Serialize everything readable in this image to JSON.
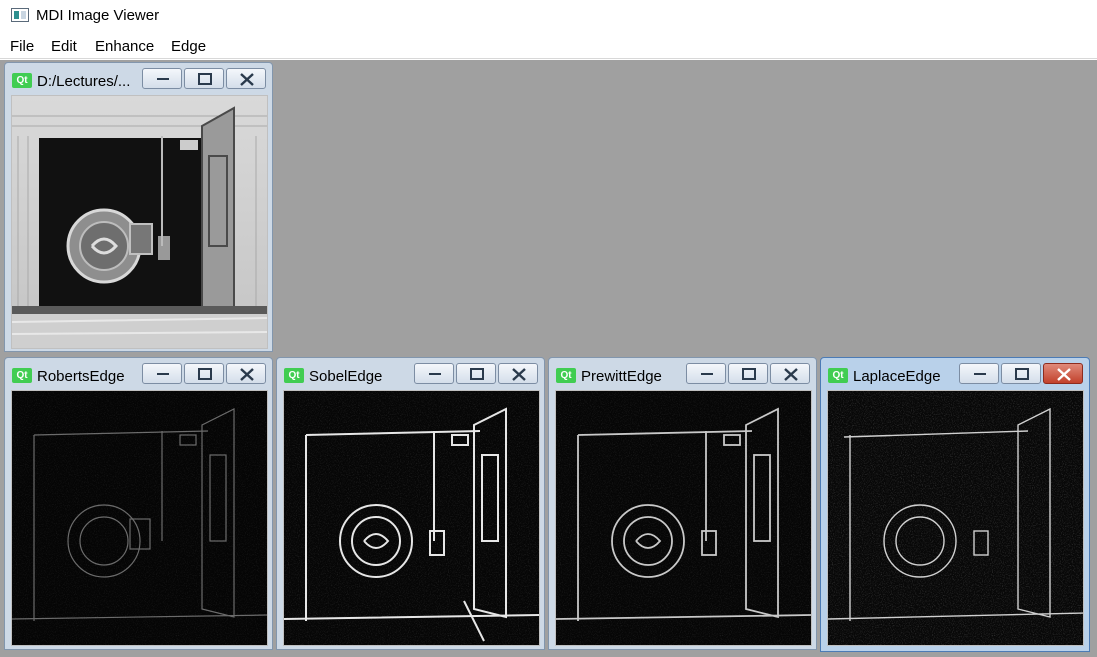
{
  "app": {
    "title": "MDI Image Viewer",
    "icon": "mdi-window-icon"
  },
  "menu": [
    "File",
    "Edit",
    "Enhance",
    "Edge"
  ],
  "windows": [
    {
      "title": "D:/Lectures/...",
      "kind": "original",
      "active": false
    },
    {
      "title": "RobertsEdge",
      "kind": "edge",
      "active": false
    },
    {
      "title": "SobelEdge",
      "kind": "edge",
      "active": false
    },
    {
      "title": "PrewittEdge",
      "kind": "edge",
      "active": false
    },
    {
      "title": "LaplaceEdge",
      "kind": "edge",
      "active": true
    }
  ],
  "window_controls": [
    "minimize",
    "maximize",
    "close"
  ],
  "qt_badge": "Qt",
  "colors": {
    "mdi_background": "#a0a0a0",
    "subwindow": "#cdd9e6",
    "active_subwindow": "#b9d1ea",
    "close_hot": "#c2412c",
    "qt_green": "#41cd52"
  }
}
